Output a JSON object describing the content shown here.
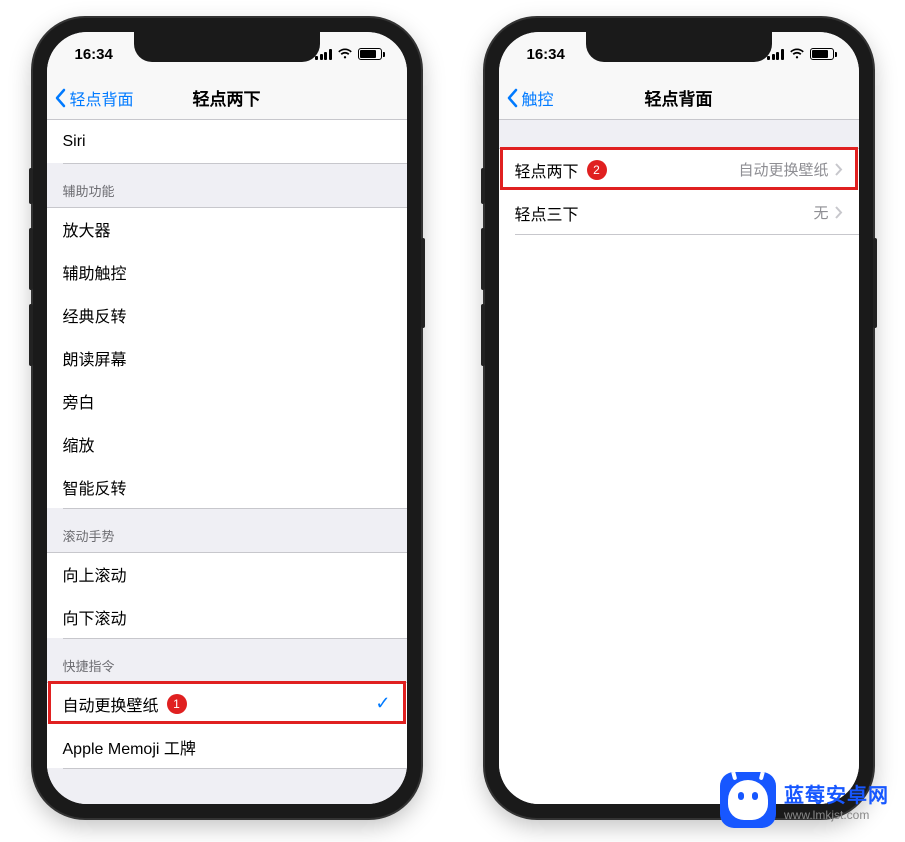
{
  "status": {
    "time": "16:34"
  },
  "phone1": {
    "nav": {
      "back": "轻点背面",
      "title": "轻点两下"
    },
    "top_item": "Siri",
    "sections": {
      "accessibility": {
        "header": "辅助功能",
        "items": [
          "放大器",
          "辅助触控",
          "经典反转",
          "朗读屏幕",
          "旁白",
          "缩放",
          "智能反转"
        ]
      },
      "scroll": {
        "header": "滚动手势",
        "items": [
          "向上滚动",
          "向下滚动"
        ]
      },
      "shortcuts": {
        "header": "快捷指令",
        "items": [
          "自动更换壁纸",
          "Apple Memoji 工牌"
        ],
        "selected_index": 0,
        "badge": "1"
      }
    }
  },
  "phone2": {
    "nav": {
      "back": "触控",
      "title": "轻点背面"
    },
    "rows": [
      {
        "label": "轻点两下",
        "value": "自动更换壁纸",
        "badge": "2"
      },
      {
        "label": "轻点三下",
        "value": "无"
      }
    ]
  },
  "watermark": {
    "title": "蓝莓安卓网",
    "url": "www.lmkjst.com"
  }
}
